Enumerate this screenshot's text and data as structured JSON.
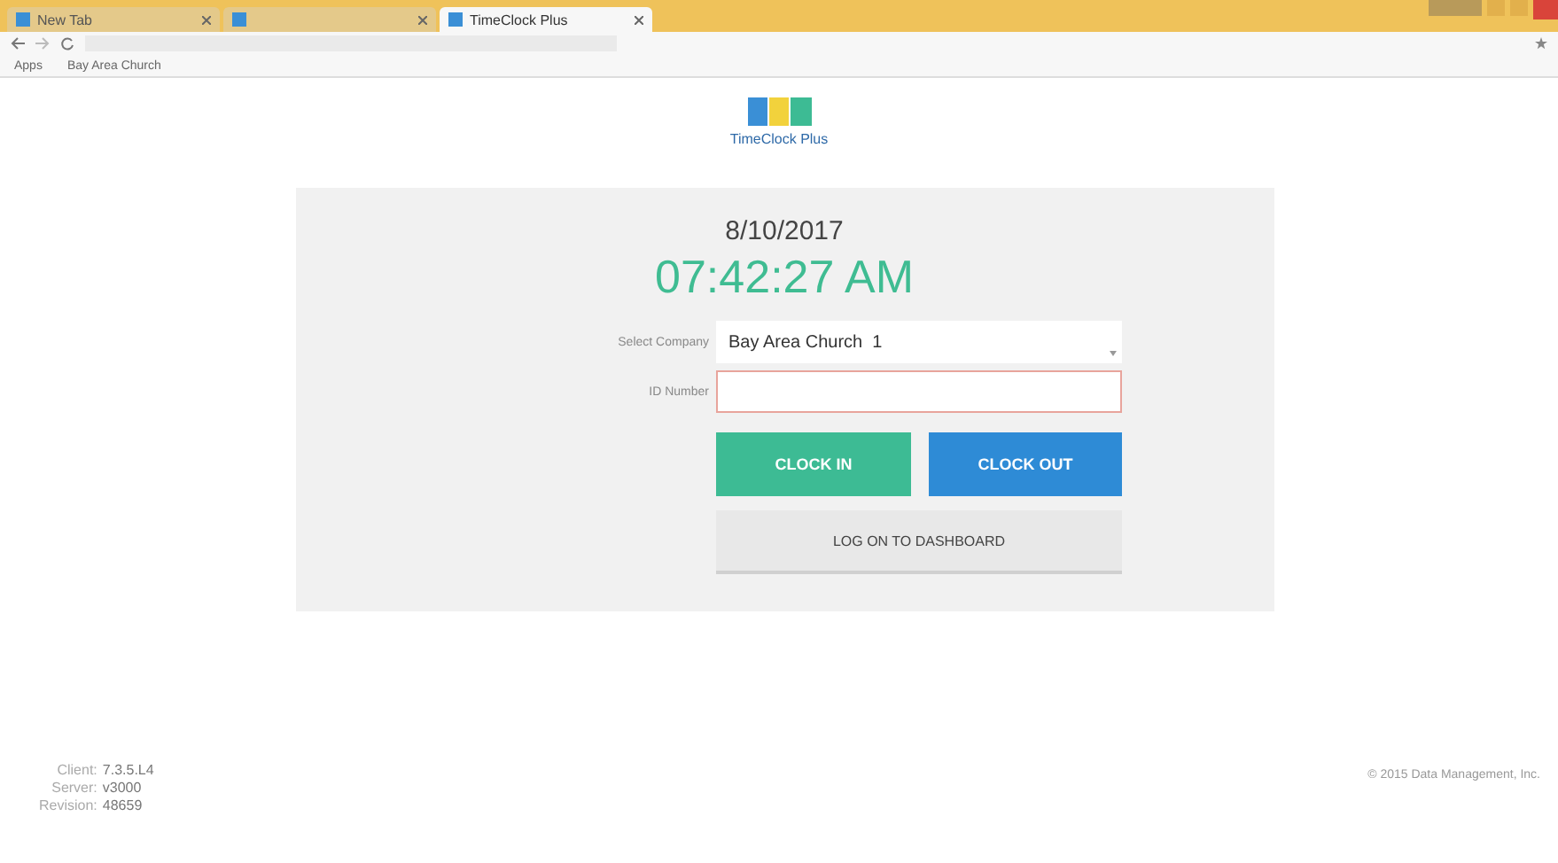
{
  "browser": {
    "tabs": [
      {
        "title": "New Tab",
        "selected": false
      },
      {
        "selected": false
      },
      {
        "title": "TimeClock Plus",
        "selected": true
      }
    ],
    "bookmarks": [
      "Apps",
      "Bay Area Church"
    ]
  },
  "logo": {
    "name": "TimeClock Plus"
  },
  "clock": {
    "date": "8/10/2017",
    "time": "07:42:27 AM"
  },
  "form": {
    "fields": [
      {
        "label": "Select Company",
        "kind": "select",
        "value": "Bay Area Church  1",
        "invalid": false
      },
      {
        "label": "ID Number",
        "kind": "text",
        "invalid": true
      }
    ],
    "buttons": [
      {
        "label": "CLOCK IN",
        "kind": "green"
      },
      {
        "label": "CLOCK OUT",
        "kind": "blue"
      },
      {
        "label": "LOG ON TO DASHBOARD",
        "kind": "gray"
      }
    ]
  },
  "versions": [
    {
      "label": "Client:",
      "value": "7.3.5.L4"
    },
    {
      "label": "Server:",
      "value": "v3000"
    },
    {
      "label": "Revision:",
      "value": "48659"
    }
  ],
  "copyright": "© 2015 Data Management, Inc."
}
